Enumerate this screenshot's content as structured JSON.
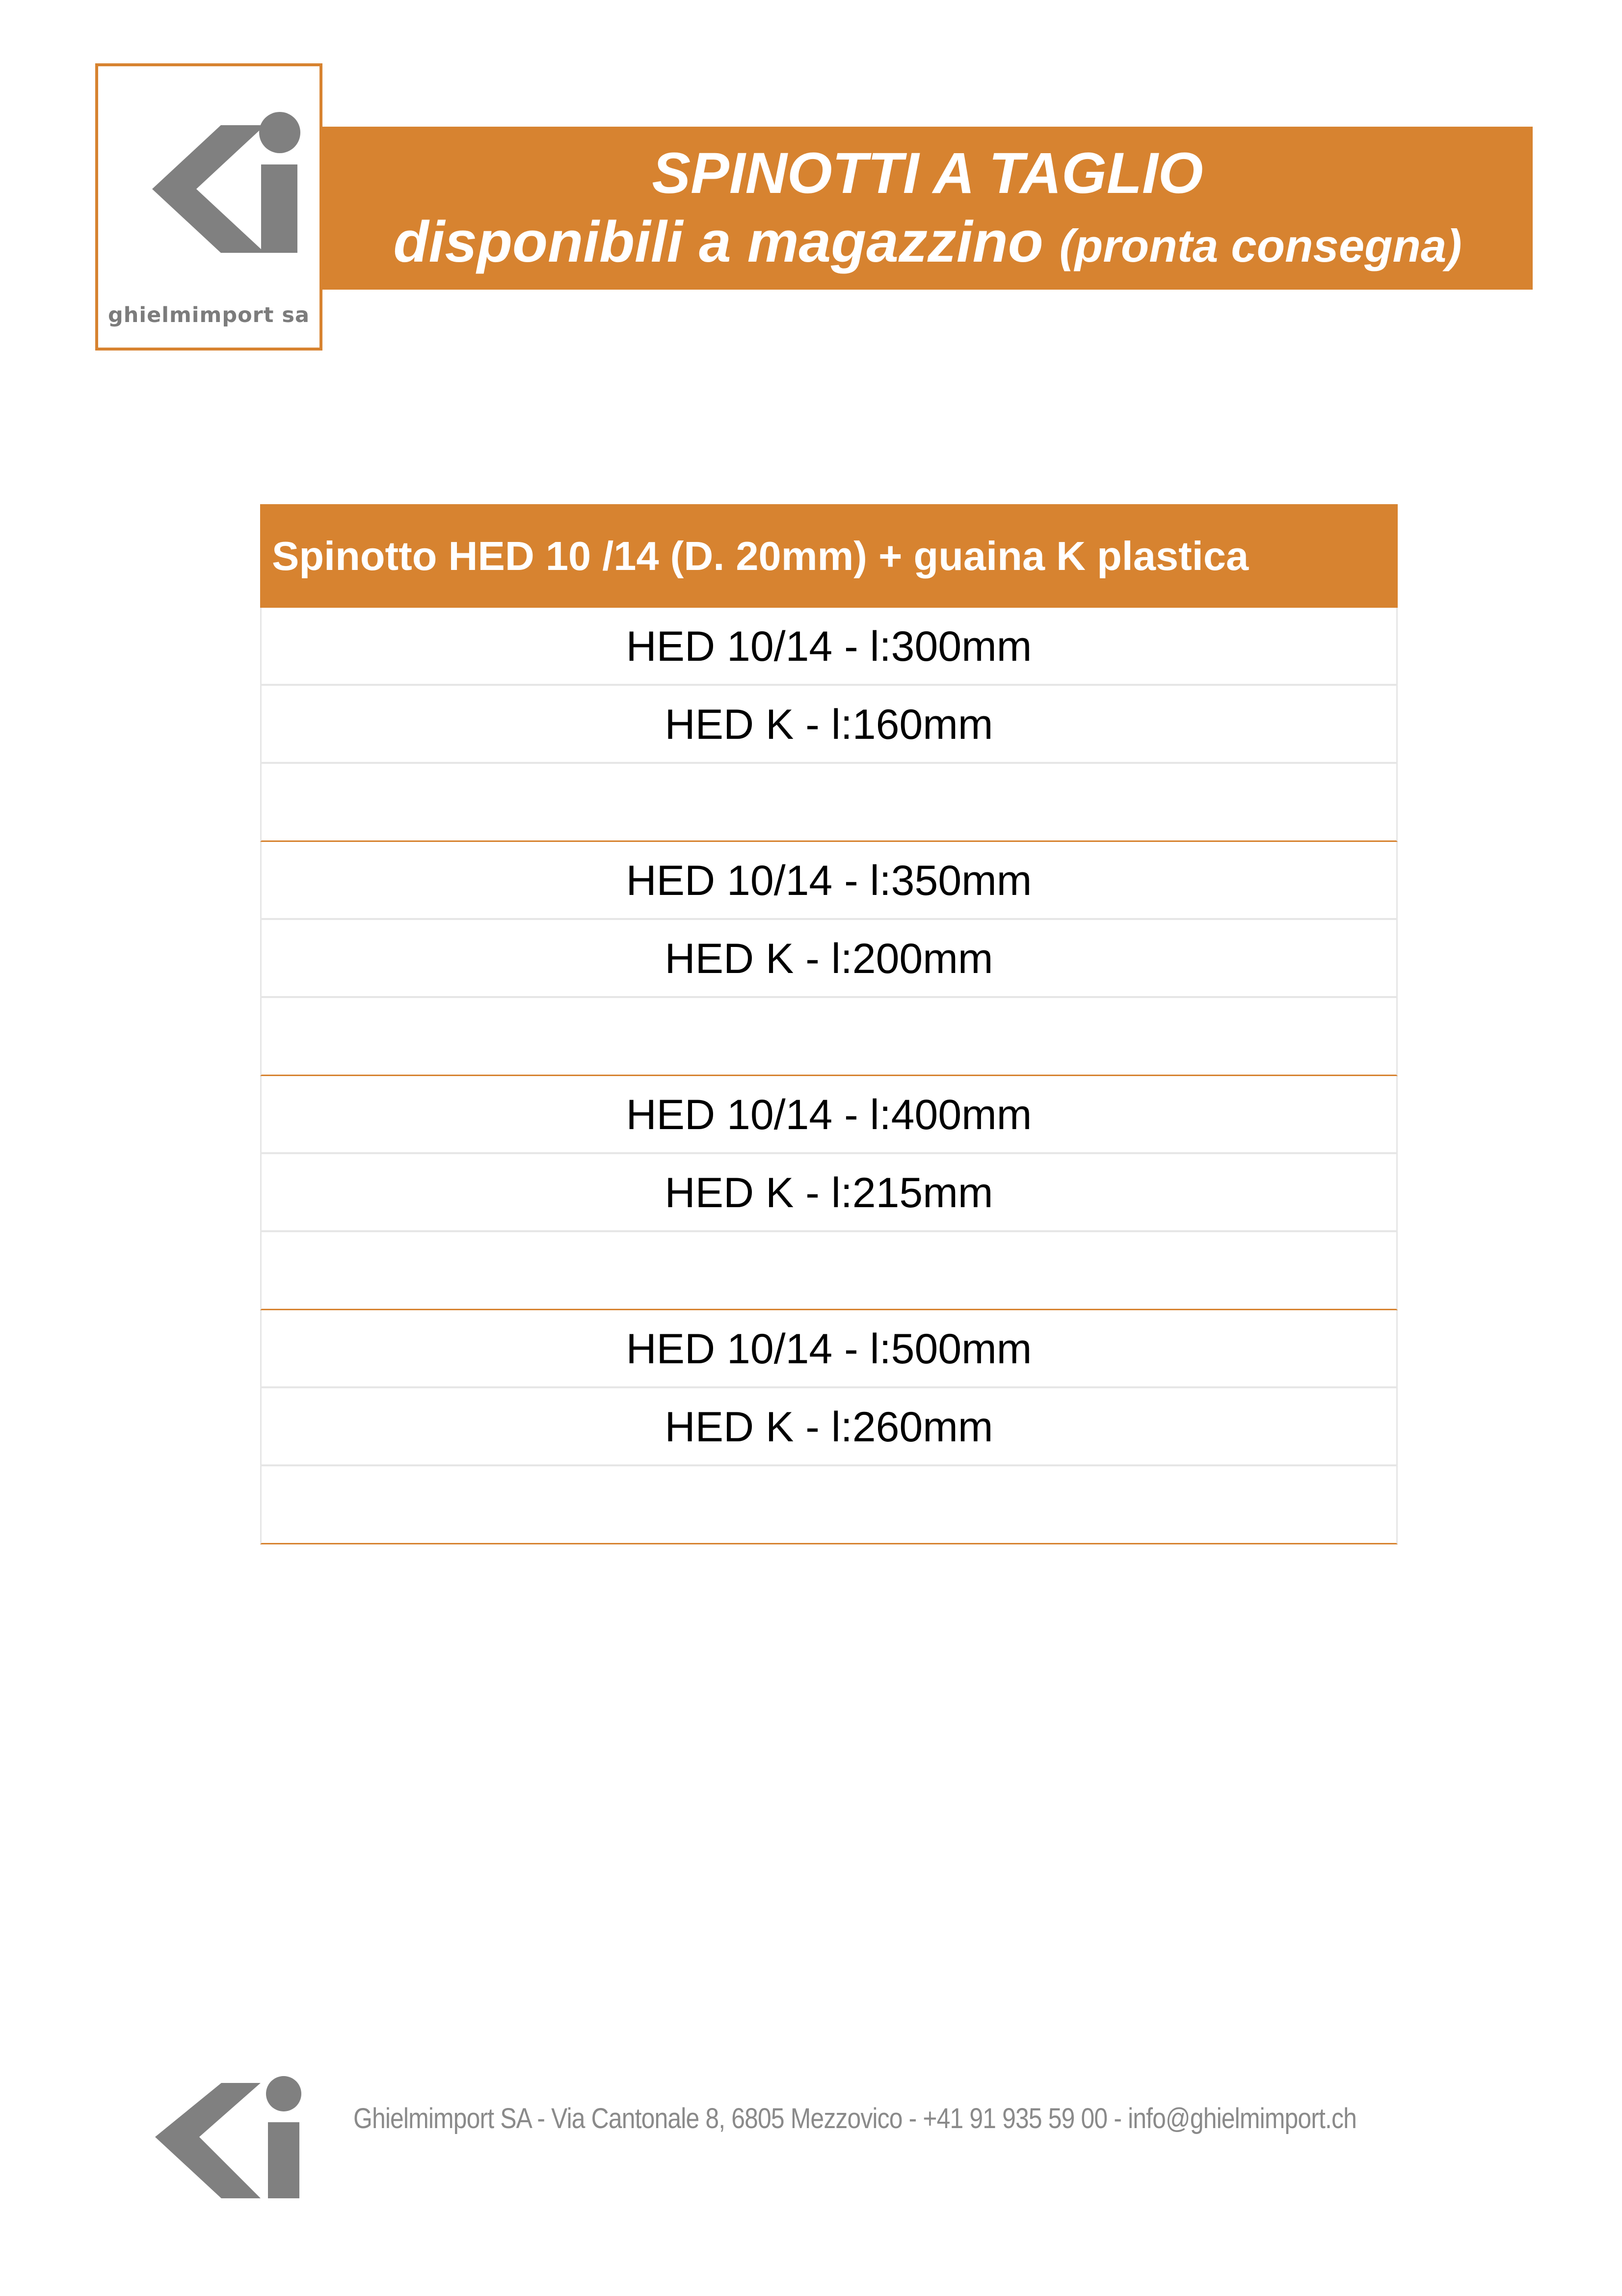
{
  "logo": {
    "brand_name": "ghielmimport sa",
    "icon": "ki-logo-icon"
  },
  "banner": {
    "line1": "SPINOTTI A TAGLIO",
    "line2_main": "disponibili a magazzino",
    "line2_small": "(pronta consegna)"
  },
  "table": {
    "header": "Spinotto HED 10 /14 (D. 20mm) + guaina K plastica",
    "groups": [
      {
        "hed": "HED 10/14 - l:300mm",
        "k": "HED K - l:160mm"
      },
      {
        "hed": "HED 10/14 - l:350mm",
        "k": "HED K - l:200mm"
      },
      {
        "hed": "HED 10/14 - l:400mm",
        "k": "HED K - l:215mm"
      },
      {
        "hed": "HED 10/14 - l:500mm",
        "k": "HED K - l:260mm"
      }
    ]
  },
  "footer": {
    "text": "Ghielmimport SA - Via Cantonale 8, 6805 Mezzovico - +41 91 935 59 00 - info@ghielmimport.ch"
  },
  "colors": {
    "accent": "#d78330",
    "logo_gray": "#808080"
  }
}
